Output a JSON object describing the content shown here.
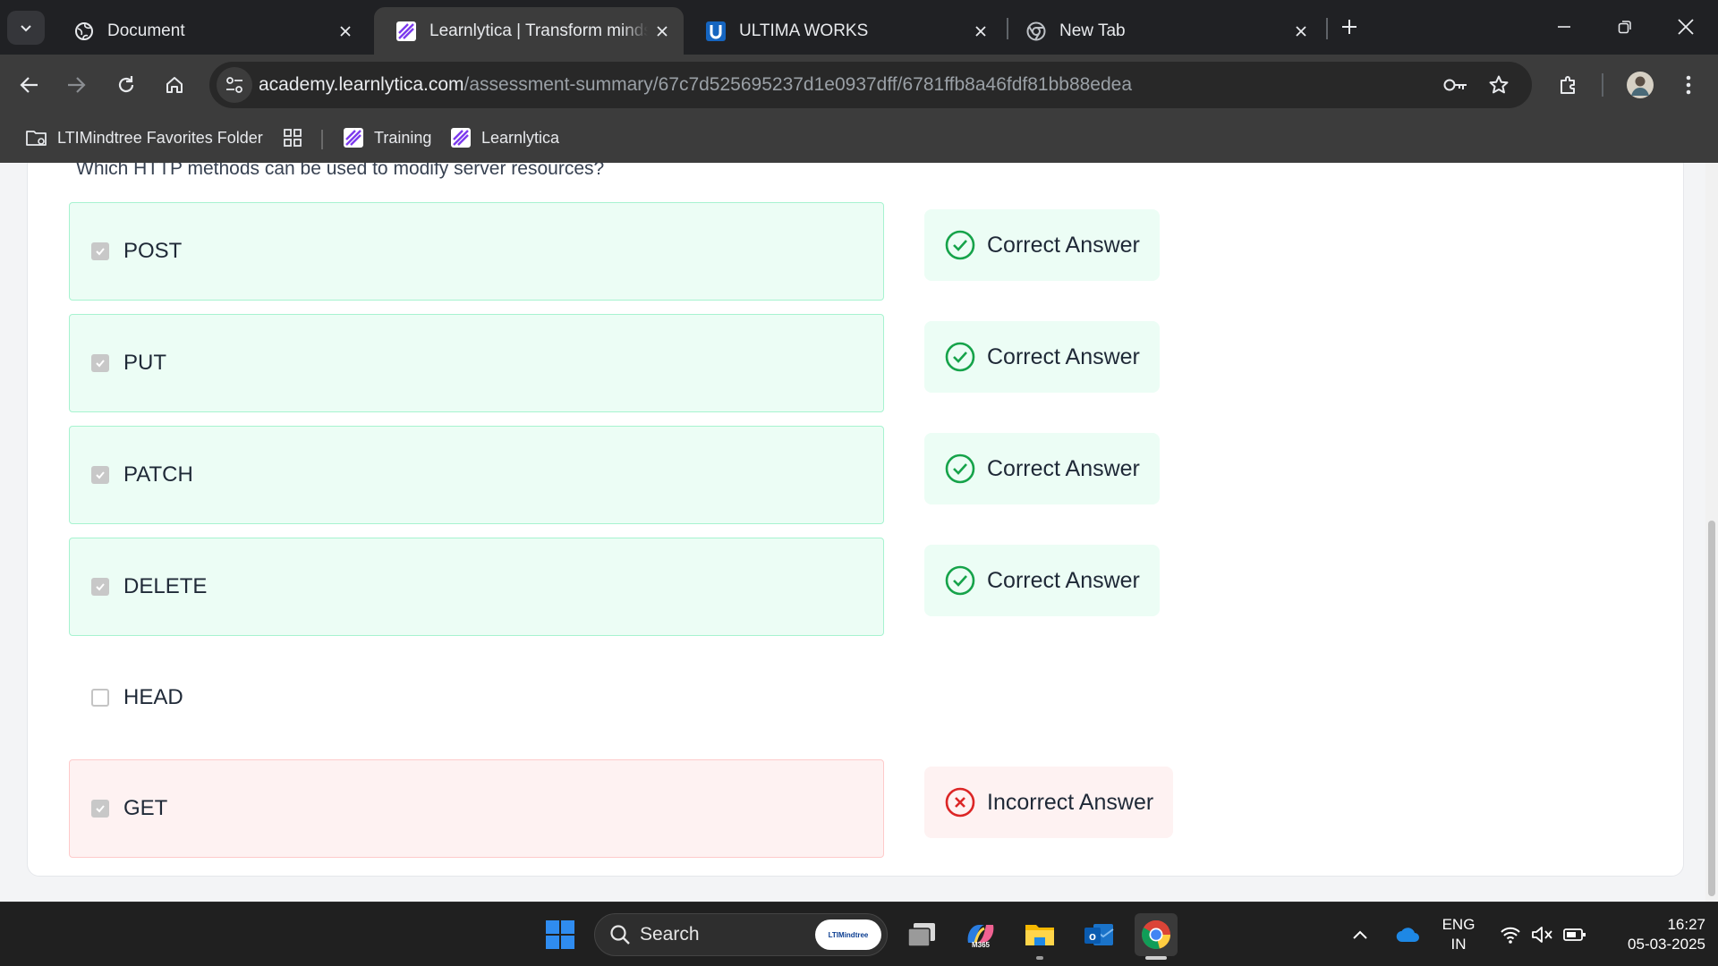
{
  "browser": {
    "tabs": [
      {
        "title": "Document",
        "active": false
      },
      {
        "title": "Learnlytica | Transform minds w",
        "active": true
      },
      {
        "title": "ULTIMA WORKS",
        "active": false
      },
      {
        "title": "New Tab",
        "active": false
      }
    ],
    "url_host": "academy.learnlytica.com",
    "url_path": "/assessment-summary/67c7d525695237d1e0937dff/6781ffb8a46fdf81bb88edea",
    "bookmarks": [
      {
        "label": "LTIMindtree Favorites Folder"
      },
      {
        "label": "Training"
      },
      {
        "label": "Learnlytica"
      }
    ]
  },
  "question": {
    "text": "Which HTTP methods can be used to modify server resources?",
    "options": [
      {
        "label": "POST",
        "selected": true,
        "status": "correct",
        "status_label": "Correct Answer"
      },
      {
        "label": "PUT",
        "selected": true,
        "status": "correct",
        "status_label": "Correct Answer"
      },
      {
        "label": "PATCH",
        "selected": true,
        "status": "correct",
        "status_label": "Correct Answer"
      },
      {
        "label": "DELETE",
        "selected": true,
        "status": "correct",
        "status_label": "Correct Answer"
      },
      {
        "label": "HEAD",
        "selected": false,
        "status": "none",
        "status_label": ""
      },
      {
        "label": "GET",
        "selected": true,
        "status": "incorrect",
        "status_label": "Incorrect Answer"
      }
    ]
  },
  "colors": {
    "correct": "#16a34a",
    "incorrect": "#dc2626",
    "accent_purple": "#7c3aed"
  },
  "taskbar": {
    "search_label": "Search",
    "search_pill": "LTIMindtree",
    "copilot_label": "M365",
    "language": "ENG",
    "region": "IN",
    "time": "16:27",
    "date": "05-03-2025"
  }
}
